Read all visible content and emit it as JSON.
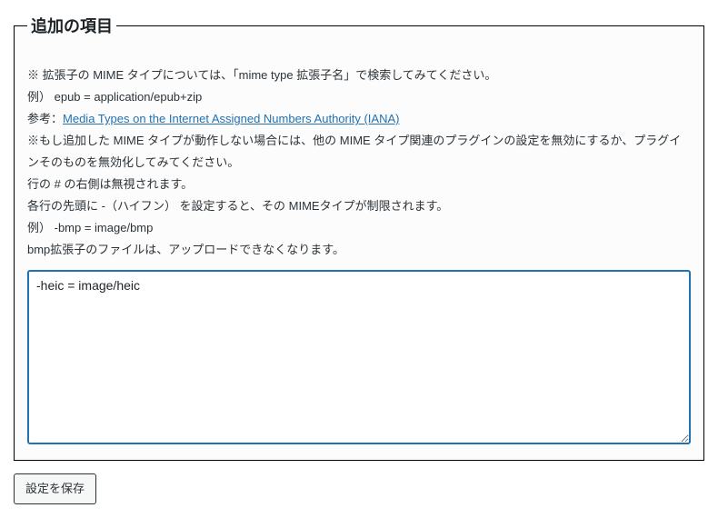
{
  "fieldset": {
    "legend": "追加の項目",
    "description": {
      "line1": "※ 拡張子の MIME タイプについては、「mime type 拡張子名」で検索してみてください。",
      "line2": "例） epub = application/epub+zip",
      "line3_prefix": "参考：",
      "line3_link_text": "Media Types on the Internet Assigned Numbers Authority (IANA)",
      "line4": "※もし追加した MIME タイプが動作しない場合には、他の MIME タイプ関連のプラグインの設定を無効にするか、プラグインそのものを無効化してみてください。",
      "line5": "行の # の右側は無視されます。",
      "line6": "各行の先頭に -（ハイフン） を設定すると、その MIMEタイプが制限されます。",
      "line7": "例）  -bmp = image/bmp",
      "line8": "bmp拡張子のファイルは、アップロードできなくなります。"
    },
    "textarea_value": "-heic = image/heic"
  },
  "actions": {
    "save_label": "設定を保存"
  }
}
